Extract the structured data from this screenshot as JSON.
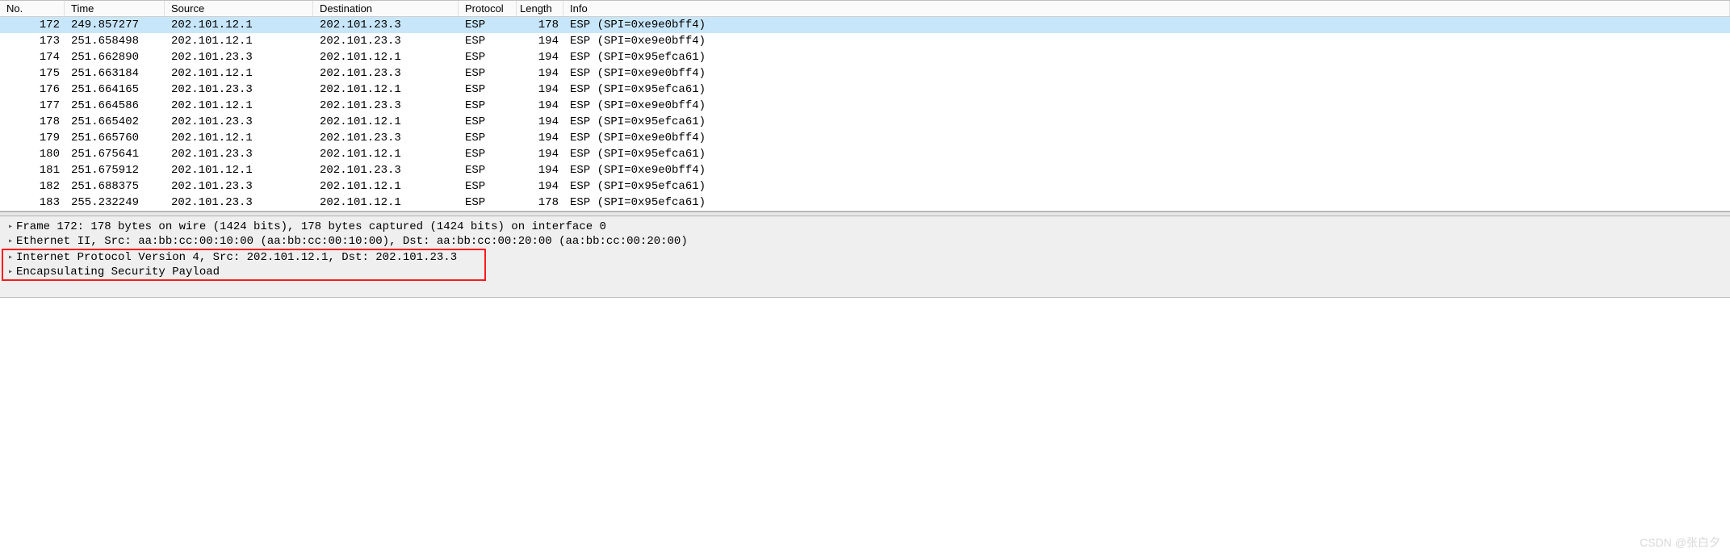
{
  "columns": {
    "no": "No.",
    "time": "Time",
    "source": "Source",
    "destination": "Destination",
    "protocol": "Protocol",
    "length": "Length",
    "info": "Info"
  },
  "packets": [
    {
      "no": "172",
      "time": "249.857277",
      "src": "202.101.12.1",
      "dst": "202.101.23.3",
      "proto": "ESP",
      "len": "178",
      "info": "ESP (SPI=0xe9e0bff4)",
      "selected": true
    },
    {
      "no": "173",
      "time": "251.658498",
      "src": "202.101.12.1",
      "dst": "202.101.23.3",
      "proto": "ESP",
      "len": "194",
      "info": "ESP (SPI=0xe9e0bff4)"
    },
    {
      "no": "174",
      "time": "251.662890",
      "src": "202.101.23.3",
      "dst": "202.101.12.1",
      "proto": "ESP",
      "len": "194",
      "info": "ESP (SPI=0x95efca61)"
    },
    {
      "no": "175",
      "time": "251.663184",
      "src": "202.101.12.1",
      "dst": "202.101.23.3",
      "proto": "ESP",
      "len": "194",
      "info": "ESP (SPI=0xe9e0bff4)"
    },
    {
      "no": "176",
      "time": "251.664165",
      "src": "202.101.23.3",
      "dst": "202.101.12.1",
      "proto": "ESP",
      "len": "194",
      "info": "ESP (SPI=0x95efca61)"
    },
    {
      "no": "177",
      "time": "251.664586",
      "src": "202.101.12.1",
      "dst": "202.101.23.3",
      "proto": "ESP",
      "len": "194",
      "info": "ESP (SPI=0xe9e0bff4)"
    },
    {
      "no": "178",
      "time": "251.665402",
      "src": "202.101.23.3",
      "dst": "202.101.12.1",
      "proto": "ESP",
      "len": "194",
      "info": "ESP (SPI=0x95efca61)"
    },
    {
      "no": "179",
      "time": "251.665760",
      "src": "202.101.12.1",
      "dst": "202.101.23.3",
      "proto": "ESP",
      "len": "194",
      "info": "ESP (SPI=0xe9e0bff4)"
    },
    {
      "no": "180",
      "time": "251.675641",
      "src": "202.101.23.3",
      "dst": "202.101.12.1",
      "proto": "ESP",
      "len": "194",
      "info": "ESP (SPI=0x95efca61)"
    },
    {
      "no": "181",
      "time": "251.675912",
      "src": "202.101.12.1",
      "dst": "202.101.23.3",
      "proto": "ESP",
      "len": "194",
      "info": "ESP (SPI=0xe9e0bff4)"
    },
    {
      "no": "182",
      "time": "251.688375",
      "src": "202.101.23.3",
      "dst": "202.101.12.1",
      "proto": "ESP",
      "len": "194",
      "info": "ESP (SPI=0x95efca61)"
    },
    {
      "no": "183",
      "time": "255.232249",
      "src": "202.101.23.3",
      "dst": "202.101.12.1",
      "proto": "ESP",
      "len": "178",
      "info": "ESP (SPI=0x95efca61)"
    }
  ],
  "details": {
    "frame": "Frame 172: 178 bytes on wire (1424 bits), 178 bytes captured (1424 bits) on interface 0",
    "ethernet": "Ethernet II, Src: aa:bb:cc:00:10:00 (aa:bb:cc:00:10:00), Dst: aa:bb:cc:00:20:00 (aa:bb:cc:00:20:00)",
    "ip": "Internet Protocol Version 4, Src: 202.101.12.1, Dst: 202.101.23.3",
    "esp": "Encapsulating Security Payload"
  },
  "watermark": "CSDN @张白夕"
}
